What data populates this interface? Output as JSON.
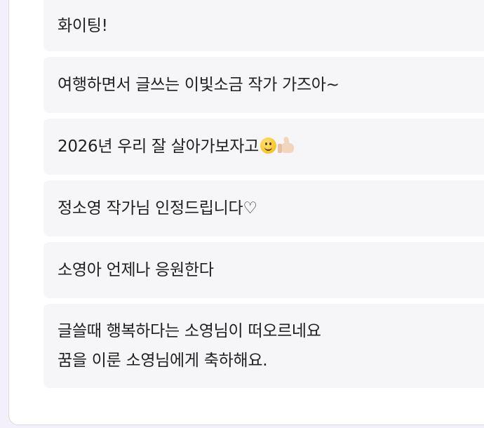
{
  "comments": [
    {
      "text": "화이팅!"
    },
    {
      "text": "여행하면서 글쓰는 이빛소금 작가 가즈아~"
    },
    {
      "text": "2026년 우리 잘 살아가보자고",
      "emojis": [
        "slightly-smiling-face",
        "thumbs-up-light-skin"
      ]
    },
    {
      "text": "정소영 작가님 인정드립니다♡"
    },
    {
      "text": "소영아 언제나 응원한다"
    },
    {
      "lines": [
        "글쓸때 행복하다는 소영님이 떠오르네요",
        "꿈을 이룬 소영님에게 축하해요."
      ]
    }
  ]
}
